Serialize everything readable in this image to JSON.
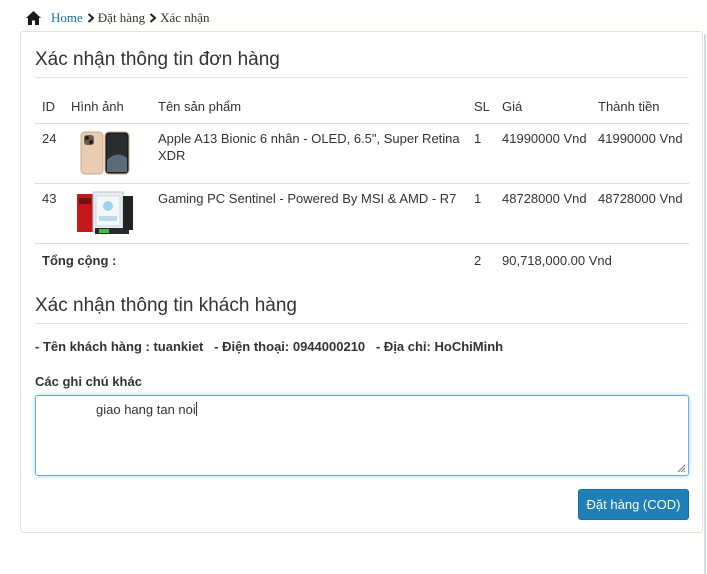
{
  "breadcrumb": {
    "home": "Home",
    "items": [
      "Đặt hàng",
      "Xác nhận"
    ]
  },
  "order_section": {
    "title": "Xác nhận thông tin đơn hàng",
    "columns": [
      "ID",
      "Hình ảnh",
      "Tên sản phẩm",
      "SL",
      "Giá",
      "Thành tiền"
    ],
    "rows": [
      {
        "id": "24",
        "image": "iphone-gold-image",
        "name": "Apple A13 Bionic 6 nhân - OLED, 6.5\", Super Retina XDR",
        "qty": "1",
        "price": "41990000 Vnd",
        "subtotal": "41990000 Vnd"
      },
      {
        "id": "43",
        "image": "gaming-pc-image",
        "name": "Gaming PC Sentinel - Powered By MSI & AMD - R7",
        "qty": "1",
        "price": "48728000 Vnd",
        "subtotal": "48728000 Vnd"
      }
    ],
    "total_label": "Tổng cộng :",
    "total_qty": "2",
    "total_amount": "90,718,000.00 Vnd"
  },
  "customer_section": {
    "title": "Xác nhận thông tin khách hàng",
    "info_line": "- Tên khách hàng : tuankiet   - Điện thoại: 0944000210   - Địa chỉ: HoChiMinh"
  },
  "notes": {
    "label": "Các ghi chú khác",
    "value": "giao hang tan noi"
  },
  "actions": {
    "order_button": "Đặt hàng (COD)"
  },
  "colors": {
    "link": "#1a6fa8",
    "total": "#d0021b",
    "button": "#1f7fb8",
    "focus": "#66afe9"
  }
}
